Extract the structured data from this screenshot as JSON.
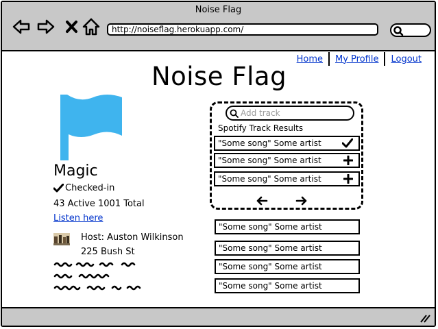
{
  "browser": {
    "window_title": "Noise Flag",
    "url": "http://noiseflag.herokuapp.com/"
  },
  "nav_links": [
    "Home",
    "My Profile",
    "Logout"
  ],
  "app_title": "Noise Flag",
  "venue": {
    "name": "Magic",
    "status": "Checked-in",
    "stats": "43 Active  1001 Total",
    "listen_link": "Listen here",
    "host": "Host: Auston Wilkinson",
    "address": "225 Bush St"
  },
  "add_track": {
    "placeholder": "Add track",
    "results_label": "Spotify Track Results",
    "results": [
      {
        "text": "\"Some song\"  Some artist",
        "action": "check"
      },
      {
        "text": "\"Some song\"  Some artist",
        "action": "plus"
      },
      {
        "text": "\"Some song\"  Some artist",
        "action": "plus"
      }
    ]
  },
  "queue": [
    "\"Some song\"  Some artist",
    "\"Some song\"  Some artist",
    "\"Some song\"  Some artist",
    "\"Some song\"  Some artist"
  ],
  "colors": {
    "chrome": "#c8c8c8",
    "flag": "#3fb4ee",
    "link": "#0033cc",
    "placeholder": "#9a9a9a"
  }
}
